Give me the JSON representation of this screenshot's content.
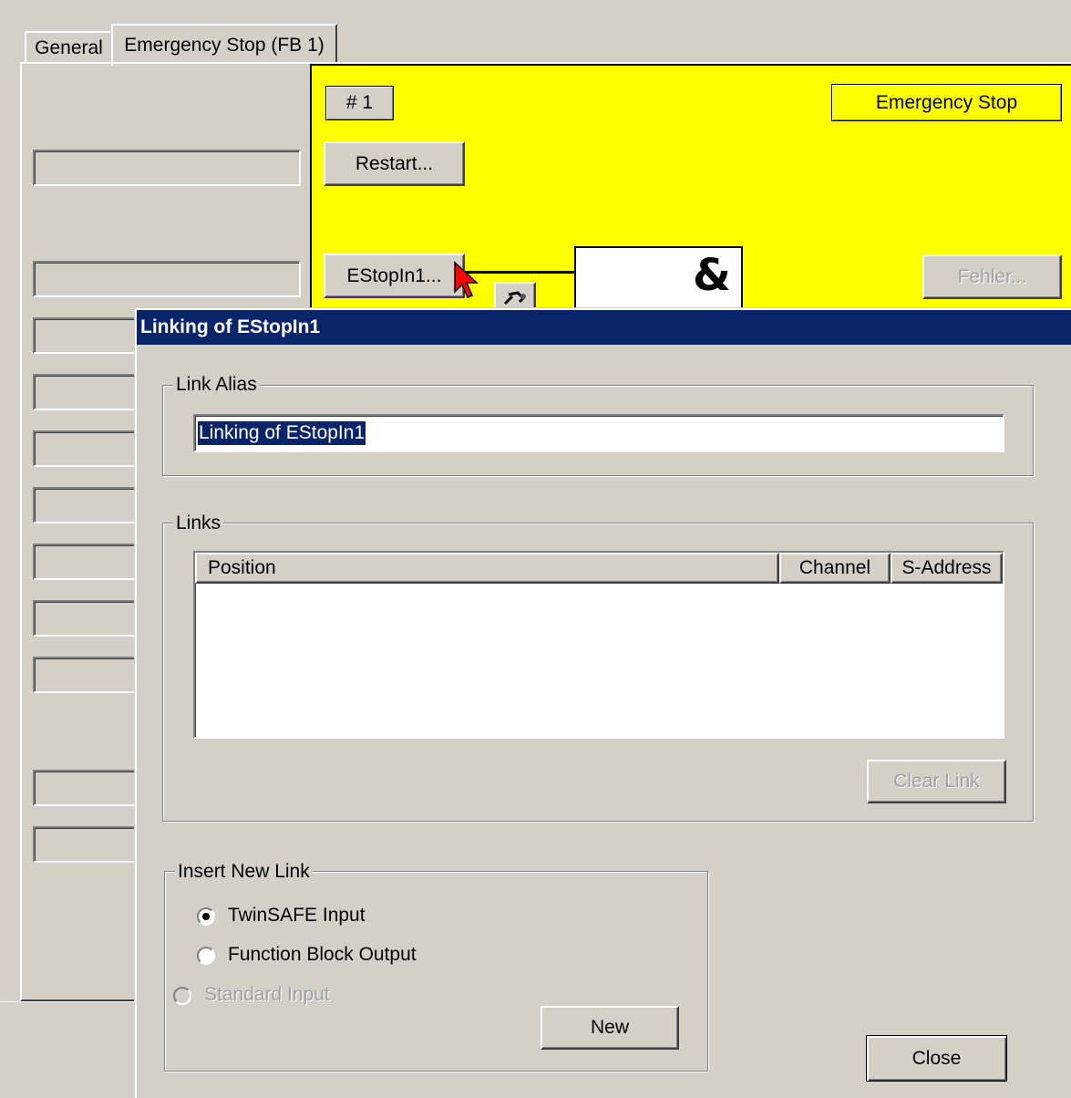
{
  "tabs": [
    {
      "label": "General"
    },
    {
      "label": "Emergency Stop (FB 1)"
    }
  ],
  "fb": {
    "number_label": "# 1",
    "name_label": "Emergency Stop",
    "restart_label": "Restart...",
    "estop_in_label": "EStopIn1...",
    "and_symbol": "&",
    "error_label": "Fehler...",
    "bg_color": "#ffff00"
  },
  "dialog": {
    "title": "Linking of EStopIn1",
    "title_bar_color": "#0a246a",
    "link_alias": {
      "group_label": "Link Alias",
      "value": "Linking of EStopIn1"
    },
    "links": {
      "group_label": "Links",
      "columns": [
        "Position",
        "Channel",
        "S-Address"
      ],
      "rows": [],
      "clear_label": "Clear Link"
    },
    "insert": {
      "group_label": "Insert New Link",
      "options": [
        {
          "label": "TwinSAFE Input",
          "checked": true,
          "enabled": true
        },
        {
          "label": "Function Block Output",
          "checked": false,
          "enabled": true
        },
        {
          "label": "Standard Input",
          "checked": false,
          "enabled": false
        }
      ],
      "new_label": "New"
    },
    "close_label": "Close"
  }
}
